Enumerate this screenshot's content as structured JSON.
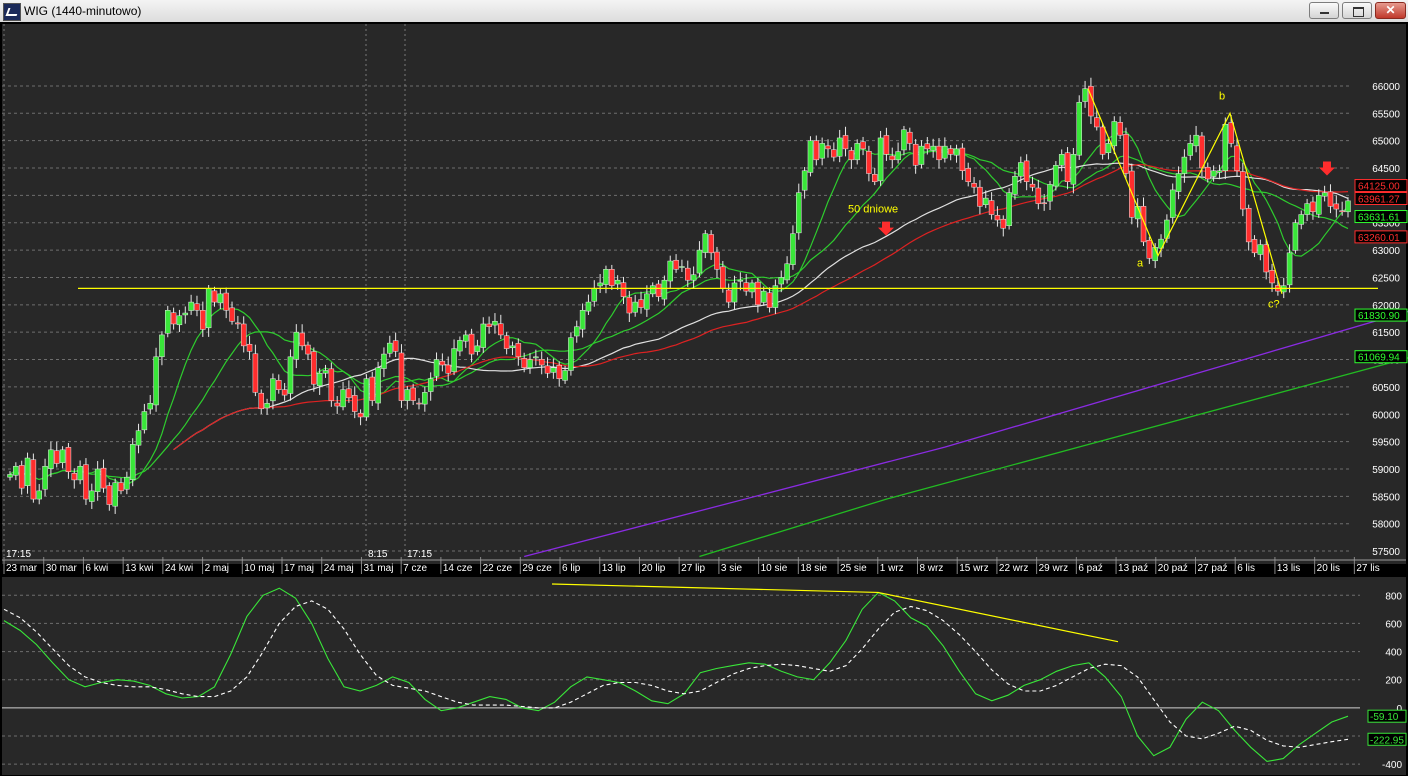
{
  "window": {
    "title": "WIG (1440-minutowo)",
    "buttons": {
      "min": "minimize",
      "max": "restore",
      "close": "✕"
    }
  },
  "chart_data": [
    {
      "type": "candlestick",
      "title": "WIG (1440-minutowo)",
      "ylim": [
        57300,
        66200
      ],
      "yticks": [
        57500,
        58000,
        58500,
        59000,
        59500,
        60000,
        60500,
        61000,
        61500,
        62000,
        62500,
        63000,
        63500,
        64000,
        64500,
        65000,
        65500,
        66000
      ],
      "ytick_labels": [
        "57500",
        "58000",
        "58500",
        "59000",
        "59500",
        "60000",
        "60500",
        "61000",
        "61500",
        "62000",
        "62500",
        "63000",
        "63500",
        "64000",
        "64500",
        "65000",
        "65500",
        "66000"
      ],
      "dates": [
        "23 mar",
        "30 mar",
        "6 kwi",
        "13 kwi",
        "24 kwi",
        "2 maj",
        "10 maj",
        "17 maj",
        "24 maj",
        "31 maj",
        "7 cze",
        "14 cze",
        "22 cze",
        "29 cze",
        "6 lip",
        "13 lip",
        "20 lip",
        "27 lip",
        "3 sie",
        "10 sie",
        "18 sie",
        "25 sie",
        "1 wrz",
        "8 wrz",
        "15 wrz",
        "22 wrz",
        "29 wrz",
        "6 paź",
        "13 paź",
        "20 paź",
        "27 paź",
        "6 lis",
        "13 lis",
        "20 lis",
        "27 lis"
      ],
      "time_labels": [
        "17:15",
        "8:15",
        "17:15"
      ],
      "closes": [
        58900,
        59050,
        58650,
        59200,
        58450,
        58600,
        59050,
        59350,
        59100,
        59350,
        58950,
        58800,
        59050,
        58450,
        58600,
        59000,
        58650,
        58350,
        58750,
        58600,
        58850,
        59450,
        59700,
        60050,
        60200,
        61050,
        61450,
        61900,
        61650,
        61800,
        61850,
        62050,
        61900,
        61550,
        62300,
        62050,
        62200,
        61900,
        61700,
        61650,
        61250,
        61150,
        60400,
        60100,
        60200,
        60650,
        60450,
        60350,
        61050,
        61500,
        61250,
        61100,
        60550,
        60750,
        60800,
        60250,
        60150,
        60450,
        60300,
        60050,
        59950,
        60650,
        60250,
        60850,
        61100,
        61300,
        61150,
        60250,
        60450,
        60250,
        60200,
        60400,
        60650,
        61000,
        60900,
        60750,
        61200,
        61350,
        61450,
        61100,
        61250,
        61650,
        61600,
        61700,
        61450,
        61200,
        61250,
        61050,
        60850,
        61000,
        61050,
        60900,
        60750,
        60850,
        60650,
        60800,
        61400,
        61600,
        61900,
        62050,
        62300,
        62400,
        62650,
        62350,
        62450,
        62150,
        61850,
        62050,
        61950,
        62200,
        62350,
        62150,
        62450,
        62800,
        62650,
        62700,
        62450,
        62550,
        63000,
        63300,
        62950,
        62650,
        62300,
        62050,
        62400,
        62450,
        62250,
        62400,
        62000,
        62250,
        61950,
        62350,
        62500,
        62750,
        63300,
        64050,
        64450,
        65000,
        64650,
        64950,
        64850,
        64700,
        65050,
        64850,
        64650,
        64950,
        64850,
        64400,
        64250,
        65050,
        64750,
        64650,
        64800,
        65200,
        64950,
        64550,
        64900,
        64850,
        64900,
        64650,
        64900,
        64750,
        64850,
        64450,
        64250,
        64150,
        63800,
        63950,
        63650,
        63550,
        63400,
        64050,
        64350,
        64600,
        64250,
        64150,
        63850,
        63850,
        64200,
        64550,
        64750,
        64250,
        64750,
        65700,
        65950,
        65450,
        65250,
        64750,
        64950,
        65350,
        65100,
        64400,
        63600,
        63800,
        63150,
        62850,
        63050,
        63200,
        63550,
        64100,
        64400,
        64700,
        64950,
        65100,
        64500,
        64300,
        64450,
        64450,
        65300,
        64950,
        64450,
        63750,
        63150,
        62950,
        63100,
        62600,
        62400,
        62250,
        62350,
        62950,
        63500,
        63650,
        63850,
        63700,
        64000,
        64050,
        63800,
        63750,
        63700,
        63900
      ],
      "sma_labels": [
        "64125.00",
        "63961.27",
        "63631.61",
        "63260.01",
        "61830.90",
        "61069.94"
      ],
      "sma_label_colors": [
        "#ff2d2d",
        "#ff2d2d",
        "#2fff2f",
        "#ff2d2d",
        "#2fff2f",
        "#2fff2f"
      ],
      "annotations": {
        "period": "50 dniowe",
        "wave_a": "a",
        "wave_b": "b",
        "wave_c": "c?"
      },
      "support_level": 62300,
      "colors": {
        "up": "#39e639",
        "down": "#ff2d2d",
        "sma_fast": "#2ecc2e",
        "sma_mid": "#e0e0e0",
        "sma_slow": "#dd2222",
        "sma_200": "#8a2be2",
        "sma_long": "#22bb22",
        "trend": "#ffff00"
      }
    },
    {
      "type": "line",
      "ylim": [
        -420,
        880
      ],
      "yticks": [
        -400,
        -200,
        0,
        200,
        400,
        600,
        800
      ],
      "ytick_labels": [
        "-400",
        "-200",
        "0",
        "200",
        "400",
        "600",
        "800"
      ],
      "series": [
        {
          "values": [
            620,
            550,
            450,
            320,
            200,
            150,
            180,
            200,
            190,
            160,
            100,
            70,
            80,
            150,
            380,
            650,
            800,
            850,
            780,
            600,
            350,
            150,
            120,
            160,
            220,
            180,
            60,
            -20,
            0,
            40,
            80,
            60,
            0,
            -20,
            40,
            150,
            220,
            200,
            180,
            120,
            50,
            30,
            100,
            250,
            280,
            300,
            320,
            310,
            260,
            220,
            200,
            320,
            480,
            700,
            820,
            760,
            640,
            580,
            440,
            260,
            100,
            50,
            90,
            160,
            200,
            260,
            300,
            320,
            220,
            80,
            -200,
            -340,
            -280,
            -80,
            40,
            -20,
            -160,
            -280,
            -380,
            -360,
            -260,
            -180,
            -100,
            -59.1
          ]
        },
        {
          "values": [
            700,
            640,
            540,
            420,
            300,
            220,
            180,
            160,
            150,
            150,
            130,
            100,
            80,
            80,
            120,
            220,
            400,
            600,
            720,
            760,
            700,
            560,
            380,
            230,
            160,
            140,
            120,
            80,
            40,
            20,
            20,
            20,
            10,
            0,
            0,
            40,
            100,
            160,
            180,
            180,
            160,
            120,
            100,
            120,
            180,
            240,
            280,
            300,
            310,
            300,
            280,
            260,
            300,
            420,
            560,
            680,
            720,
            690,
            620,
            520,
            400,
            270,
            170,
            120,
            120,
            160,
            220,
            280,
            310,
            300,
            220,
            60,
            -100,
            -200,
            -220,
            -180,
            -130,
            -160,
            -230,
            -270,
            -280,
            -260,
            -240,
            -222.95
          ]
        }
      ],
      "last_labels": [
        "-59.10",
        "-222.95"
      ]
    }
  ]
}
